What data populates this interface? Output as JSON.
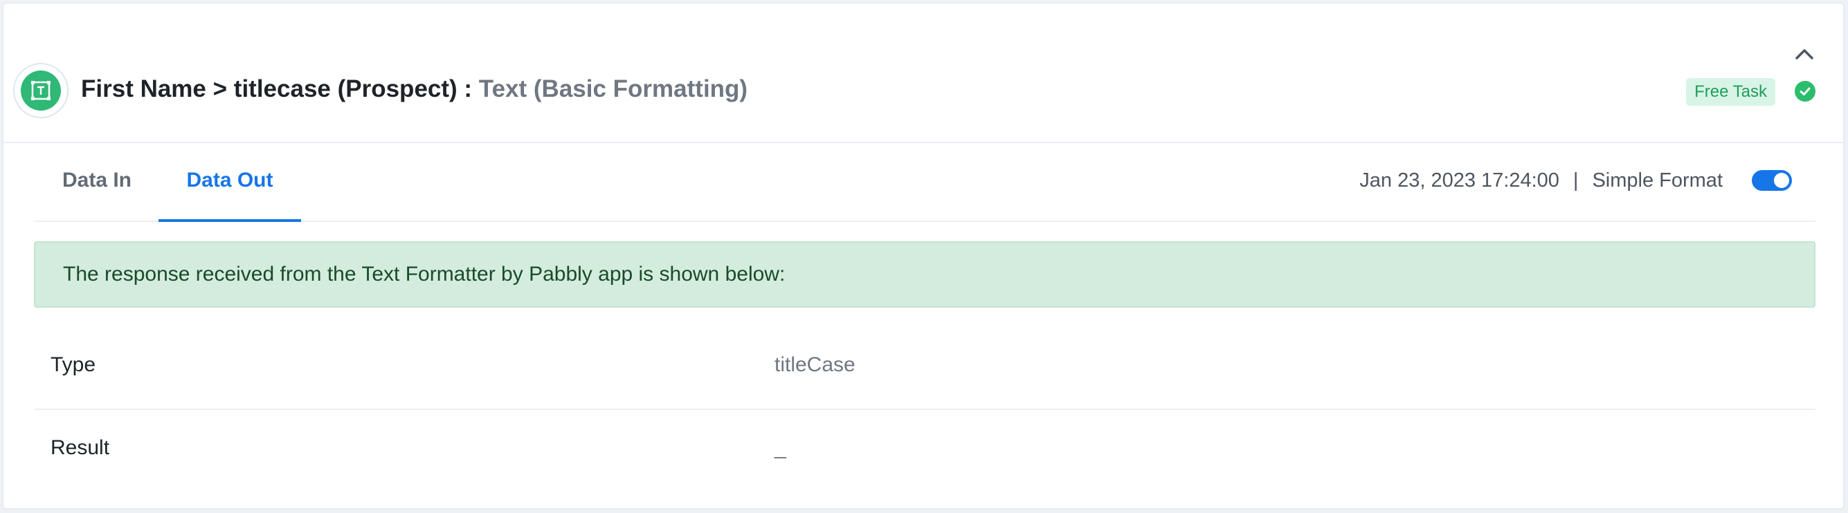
{
  "header": {
    "title": "First Name > titlecase (Prospect) :",
    "subtitle": "Text (Basic Formatting)",
    "badge": "Free Task",
    "icons": {
      "app": "text-formatter-icon",
      "collapse": "chevron-up-icon",
      "status": "check-circle-icon"
    }
  },
  "tabs": [
    {
      "label": "Data In"
    },
    {
      "label": "Data Out"
    }
  ],
  "meta": {
    "timestamp": "Jan 23, 2023 17:24:00",
    "separator": "|",
    "format_label": "Simple Format",
    "simple_format_enabled": true
  },
  "alert": {
    "text": "The response received from the Text Formatter by Pabbly app is shown below:"
  },
  "table": [
    {
      "key": "Type",
      "value": "titleCase"
    },
    {
      "key": "Result",
      "value": "_"
    }
  ],
  "colors": {
    "accent": "#1676e8",
    "app_icon": "#2fb876",
    "badge_bg": "#d8f4e6",
    "badge_text": "#1e9e5a",
    "alert_bg": "#d4ecdd"
  }
}
